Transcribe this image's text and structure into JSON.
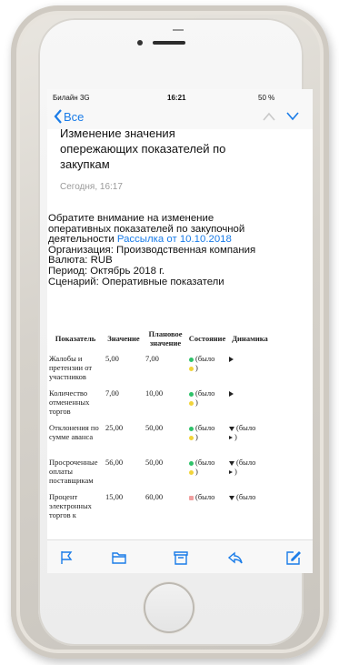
{
  "status": {
    "carrier": "Билайн 3G",
    "time": "16:21",
    "battery": "50 %"
  },
  "nav": {
    "back_label": "Все"
  },
  "email": {
    "subject_lines": [
      "Изменение значения",
      "опережающих показателей по",
      "закупкам"
    ],
    "date": "Сегодня, 16:17",
    "body": {
      "line1": "Обратите внимание на изменение",
      "line2": "оперативных показателей по закупочной",
      "line3_prefix": "деятельности ",
      "link": "Рассылка от 10.10.2018",
      "org": "Организация: Производственная компания",
      "currency": "Валюта: RUB",
      "period": "Период: Октябрь 2018 г.",
      "scenario": "Сценарий: Оперативные показатели"
    }
  },
  "table": {
    "headers": {
      "indicator": "Показатель",
      "value": "Значение",
      "plan": "Плановое значение",
      "state": "Состояние",
      "dynamics": "Динамика"
    },
    "rows": [
      {
        "indicator": "Жалобы и претензии от участников",
        "value": "5,00",
        "plan": "7,00",
        "state": "(было",
        "dynamics": ""
      },
      {
        "indicator": "Количество отмененных торгов",
        "value": "7,00",
        "plan": "10,00",
        "state": "(было",
        "dynamics": ""
      },
      {
        "indicator": "Отклонения по сумме аванса",
        "value": "25,00",
        "plan": "50,00",
        "state": "(было",
        "dynamics": "(было"
      },
      {
        "indicator": "Просроченные оплаты поставщикам",
        "value": "56,00",
        "plan": "50,00",
        "state": "(было",
        "dynamics": "(было"
      },
      {
        "indicator": "Процент электронных торгов к",
        "value": "15,00",
        "plan": "60,00",
        "state": "(было",
        "dynamics": "(было"
      }
    ]
  },
  "colors": {
    "accent": "#1a7ce8",
    "green": "#2fc26a",
    "yellow": "#f2d43a",
    "pink": "#f0a0a0"
  }
}
